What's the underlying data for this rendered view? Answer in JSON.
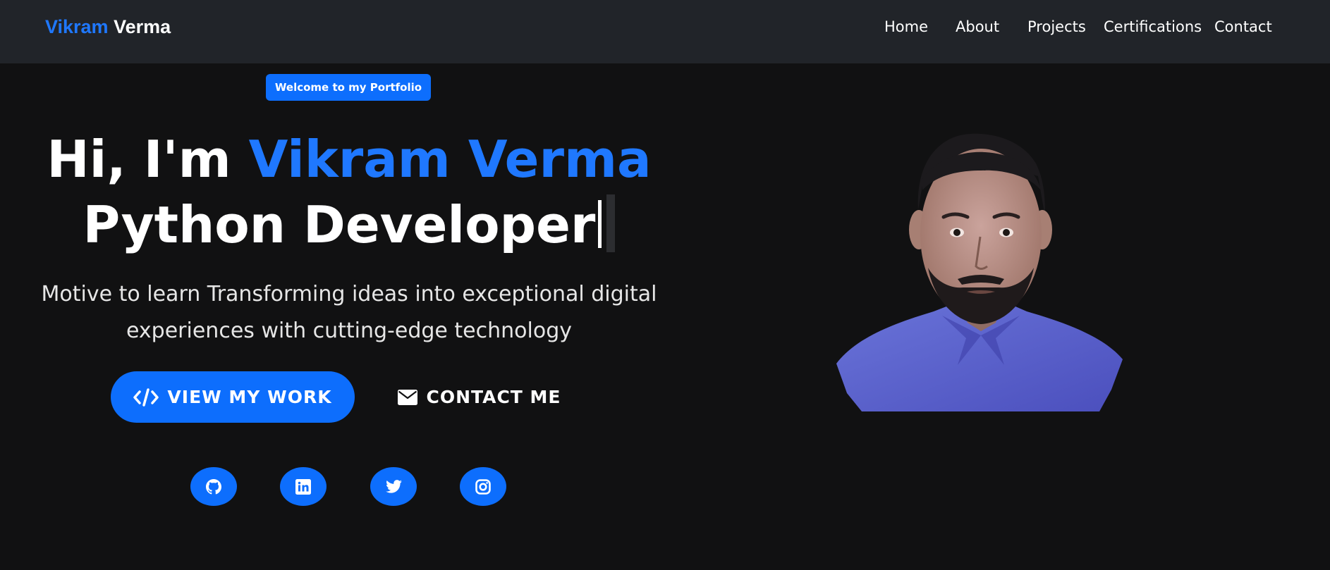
{
  "navbar": {
    "brand_first": "Vikram",
    "brand_last": "Verma",
    "links": [
      "Home",
      "About",
      "Projects",
      "Certifications",
      "Contact"
    ]
  },
  "hero": {
    "badge": "Welcome to my Portfolio",
    "greeting": "Hi, I'm",
    "name": "Vikram Verma",
    "typed_role": "Python Developer",
    "subtitle_line1": "Motive to learn Transforming ideas into exceptional digital",
    "subtitle_line2": "experiences with cutting-edge technology",
    "primary_button": "VIEW MY WORK",
    "secondary_button": "CONTACT ME",
    "social_icons": [
      "github-icon",
      "linkedin-icon",
      "twitter-icon",
      "instagram-icon"
    ],
    "portrait": "profile-photo"
  },
  "colors": {
    "accent": "#0d6efd",
    "accent_text": "#1f78ff",
    "navbar_bg": "#212429",
    "hero_bg": "#111112",
    "text": "#ffffff"
  }
}
